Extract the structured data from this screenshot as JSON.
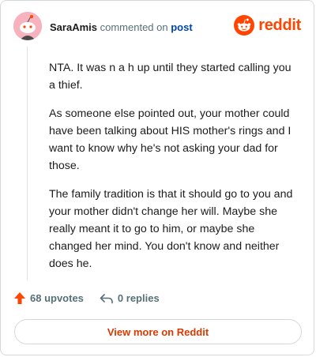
{
  "comment": {
    "author": "SaraAmis",
    "action_text": "commented on",
    "post_link_text": "post",
    "paragraphs": [
      "NTA. It was n a h up until they started calling you a thief.",
      "As someone else pointed out, your mother could have been talking about HIS mother's rings and I want to know why he's not asking your dad for those.",
      "The family tradition is that it should go to you and your mother didn't change her will. Maybe she really meant it to go to him, or maybe she changed her mind. You don't know and neither does he."
    ]
  },
  "brand": {
    "name": "reddit",
    "color": "#ff4500"
  },
  "actions": {
    "upvotes": "68 upvotes",
    "replies": "0 replies"
  },
  "footer": {
    "view_more_label": "View more on Reddit"
  },
  "icons": {
    "avatar": "snoo-avatar-icon",
    "logo": "reddit-snoo-icon",
    "upvote": "upvote-arrow-icon",
    "reply": "reply-arrow-icon"
  }
}
